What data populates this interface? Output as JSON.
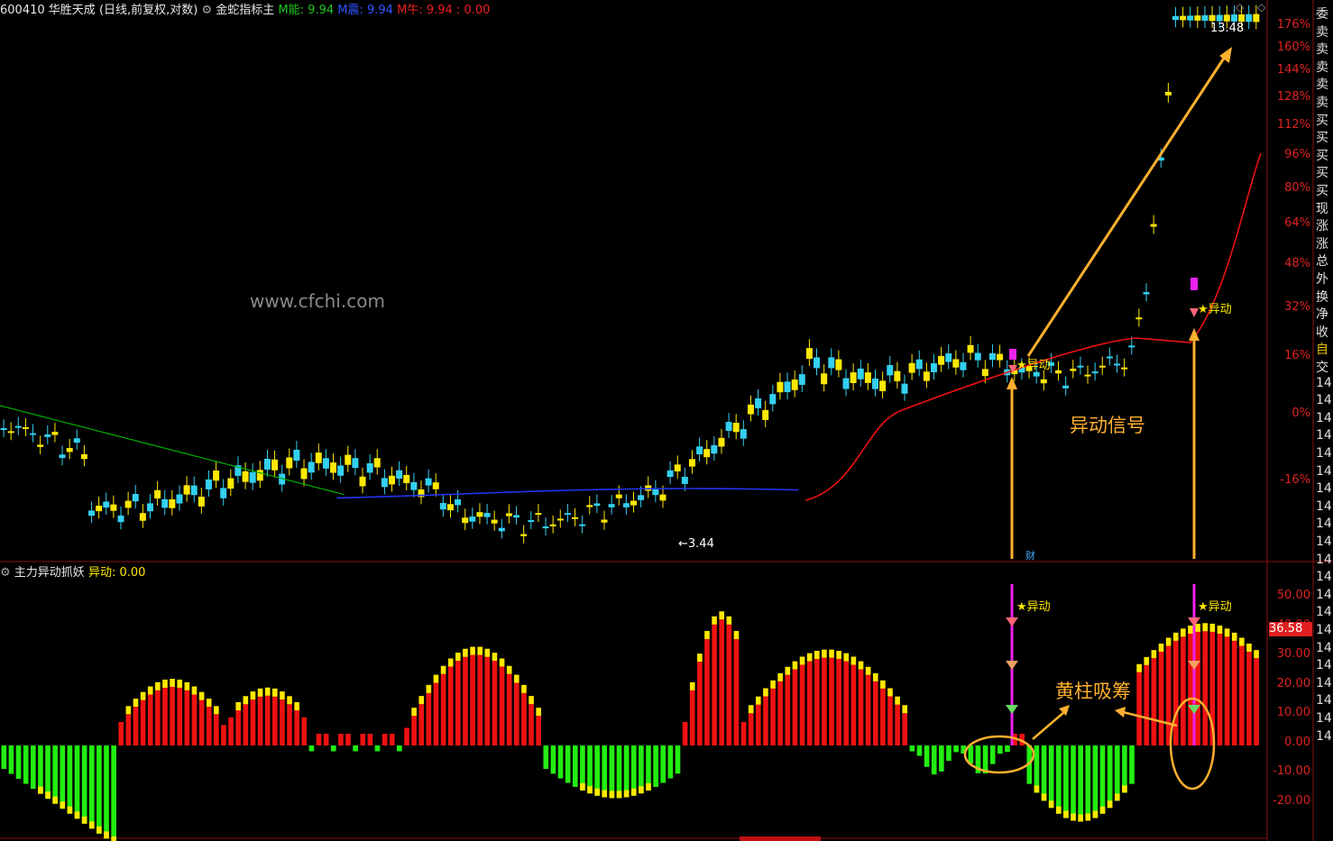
{
  "header": {
    "code": "600410",
    "name": "华胜天成",
    "period": "(日线,前复权,对数)",
    "indicator_name": "金蛇指标主",
    "m_neng_label": "M能: 9.94",
    "m_zhen_label": "M震: 9.94",
    "m_niu_label": "M牛: 9.94 : 0.00"
  },
  "sub_header": {
    "indicator_name": "主力异动抓妖",
    "value_label": "异动: 0.00"
  },
  "watermark": "www.cfchi.com",
  "annotations": {
    "signal": "异动信号",
    "accumulate": "黄柱吸筹",
    "star_label": "★异动",
    "cai_badge": "财",
    "high_price": "13.48",
    "low_price": "3.44"
  },
  "axes": {
    "price_pct": [
      "176%",
      "160%",
      "144%",
      "128%",
      "112%",
      "96%",
      "80%",
      "64%",
      "48%",
      "32%",
      "16%",
      "0%",
      "-16%"
    ],
    "indicator": [
      "50.00",
      "40.00",
      "30.00",
      "20.00",
      "10.00",
      "0.00",
      "-10.00",
      "-20.00"
    ],
    "current_value": "36.58"
  },
  "side_panel": {
    "labels": [
      "委",
      "卖",
      "卖",
      "卖",
      "卖",
      "卖",
      "买",
      "买",
      "买",
      "买",
      "买",
      "现",
      "涨",
      "涨",
      "总",
      "外",
      "换",
      "净",
      "收",
      "自",
      "交",
      "14",
      "14",
      "14",
      "14",
      "14",
      "14",
      "14",
      "14",
      "14",
      "14",
      "14",
      "14",
      "14",
      "14",
      "14",
      "14",
      "14",
      "14",
      "14",
      "14",
      "14"
    ]
  },
  "colors": {
    "up": "#ffe800",
    "down": "#33d0f0",
    "red": "#ee1111",
    "green": "#22ee11",
    "ma_green": "#00b000",
    "ma_blue": "#2233ee",
    "ma_red": "#ee1111",
    "annotation": "#ffb02e",
    "magenta": "#ee22ee"
  },
  "chart_data": {
    "type": "candlestick_with_histogram",
    "price_high": 13.48,
    "price_low": 3.44,
    "indicator_range": [
      -20,
      50
    ],
    "indicator_current": 36.58,
    "signal_bars": [
      130,
      155
    ]
  }
}
